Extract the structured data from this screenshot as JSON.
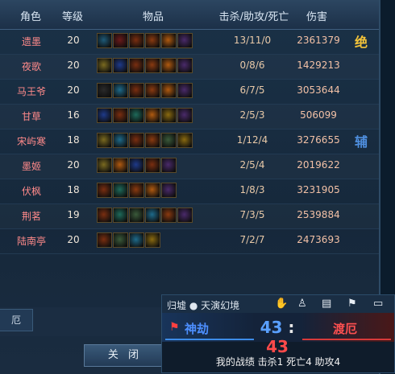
{
  "headers": {
    "role": "角色",
    "level": "等级",
    "items": "物品",
    "kda": "击杀/助攻/死亡",
    "damage": "伤害"
  },
  "rows": [
    {
      "name": "遗墨",
      "level": "20",
      "kda": "13/11/0",
      "damage": "2361379",
      "tag": "绝",
      "tag_color": "#f4c43a"
    },
    {
      "name": "夜歌",
      "level": "20",
      "kda": "0/8/6",
      "damage": "1429213",
      "tag": "",
      "tag_color": ""
    },
    {
      "name": "马王爷",
      "level": "20",
      "kda": "6/7/5",
      "damage": "3053644",
      "tag": "",
      "tag_color": ""
    },
    {
      "name": "甘草",
      "level": "16",
      "kda": "2/5/3",
      "damage": "506099",
      "tag": "",
      "tag_color": ""
    },
    {
      "name": "宋屿寒",
      "level": "18",
      "kda": "1/12/4",
      "damage": "3276655",
      "tag": "辅",
      "tag_color": "#4f8fdf"
    },
    {
      "name": "墨姬",
      "level": "20",
      "kda": "2/5/4",
      "damage": "2019622",
      "tag": "",
      "tag_color": ""
    },
    {
      "name": "伏枫",
      "level": "18",
      "kda": "1/8/3",
      "damage": "3231905",
      "tag": "",
      "tag_color": ""
    },
    {
      "name": "荆茗",
      "level": "19",
      "kda": "7/3/5",
      "damage": "2539884",
      "tag": "",
      "tag_color": ""
    },
    {
      "name": "陆南亭",
      "level": "20",
      "kda": "7/2/7",
      "damage": "2473693",
      "tag": "",
      "tag_color": ""
    }
  ],
  "left_hint": "厄",
  "close_button": "关 闭",
  "overlay": {
    "title": "归墟 ● 天演幻境",
    "blue_team": "神劫",
    "blue_score": "43",
    "red_score": "43",
    "red_team": "渡厄",
    "stats": "我的战绩   击杀1  死亡4  助攻4"
  },
  "colors": {
    "blue": "#4d8fff",
    "red": "#ff4a4a",
    "name_red": "#ff8a8a"
  }
}
